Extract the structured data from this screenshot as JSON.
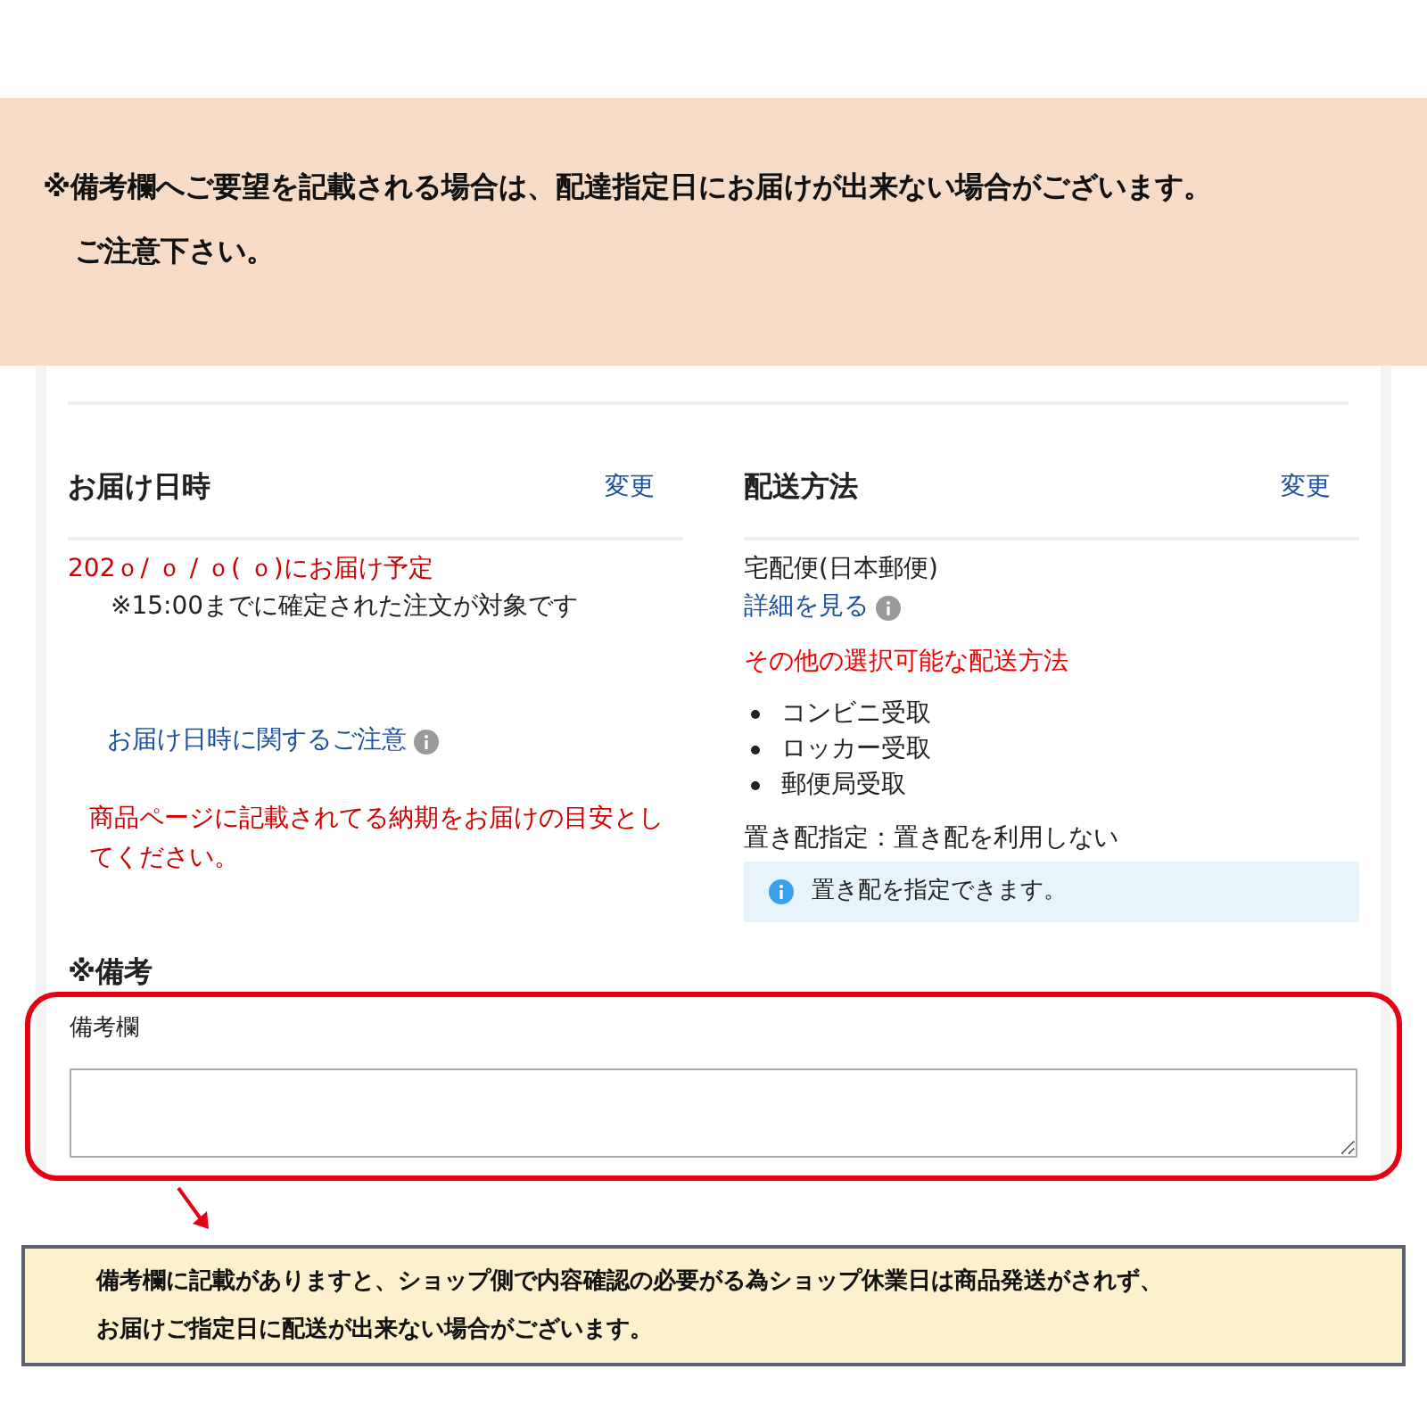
{
  "banner": {
    "lines": [
      "※備考欄へご要望を記載される場合は、配達指定日にお届けが出来ない場合がございます。",
      "ご注意下さい。"
    ]
  },
  "delivery_datetime": {
    "title": "お届け日時",
    "change_link": "変更",
    "schedule": "202ｏ/ ｏ / ｏ( ｏ)にお届け予定",
    "cutoff_note": "※15:00までに確定された注文が対象です",
    "notice_link": "お届け日時に関するご注意",
    "warning": "商品ページに記載されてる納期をお届けの目安としてください。"
  },
  "shipping_method": {
    "title": "配送方法",
    "change_link": "変更",
    "method": "宅配便(日本郵便)",
    "details_link": "詳細を見る",
    "other_heading": "その他の選択可能な配送方法",
    "other_methods": [
      "コンビニ受取",
      "ロッカー受取",
      "郵便局受取"
    ],
    "drop_off": "置き配指定：置き配を利用しない",
    "drop_off_info": "置き配を指定できます。"
  },
  "remarks": {
    "heading": "※備考",
    "field_label": "備考欄"
  },
  "callout": {
    "lines": [
      "備考欄に記載がありますと、ショップ側で内容確認の必要がる為ショップ休業日は商品発送がされず、",
      "お届けご指定日に配送が出来ない場合がございます。"
    ]
  }
}
